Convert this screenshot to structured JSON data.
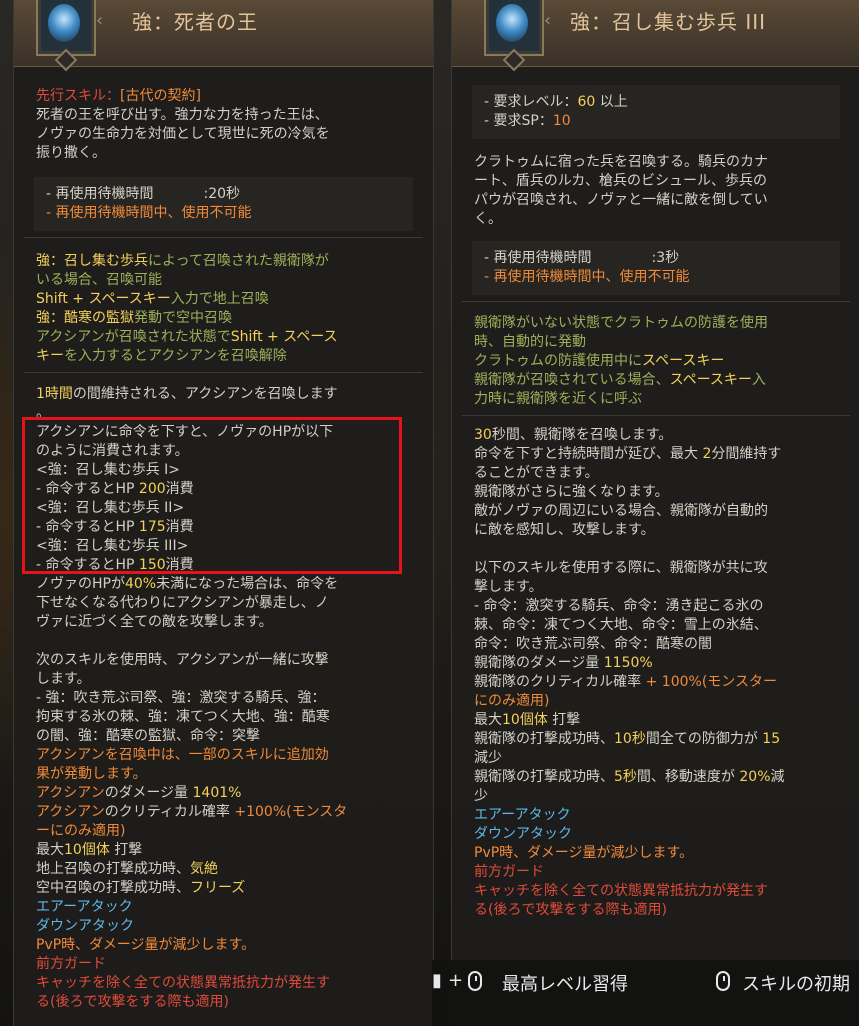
{
  "left": {
    "title": "強：死者の王",
    "prereq_label": "先行スキル：",
    "prereq_value": "[古代の契約]",
    "desc": [
      "死者の王を呼び出す。強力な力を持った王は、",
      "ノヴァの生命力を対価として現世に死の冷気を",
      "振り撒く。"
    ],
    "cooldown_label": "- 再使用待機時間",
    "cooldown_value": ":20秒",
    "cooldown_warning": "- 再使用待機時間中、使用不可能",
    "cond": {
      "l1a": "強：召し集む歩兵",
      "l1b": "によって召喚された親衛隊が",
      "l2": "いる場合、召喚可能",
      "l3a": "Shift + スペースキー",
      "l3b": "入力で地上召喚",
      "l4a": "強：酷寒の監獄",
      "l4b": "発動で空中召喚",
      "l5a": "アクシアンが召喚された状態で",
      "l5b": "Shift + スペース",
      "l6a": "キー",
      "l6b": "を入力するとアクシアンを召喚解除"
    },
    "main": {
      "l1a": "1時間",
      "l1b": "の間維持される、アクシアンを召喚します",
      "l2": "。",
      "l3": "アクシアンに命令を下すと、ノヴァのHPが以下",
      "l4": "のように消費されます。",
      "l5": "<強：召し集む歩兵 I>",
      "l6a": " - 命令するとHP ",
      "l6b": "200",
      "l6c": "消費",
      "l7": " <強：召し集む歩兵 II>",
      "l8a": "  - 命令するとHP ",
      "l8b": "175",
      "l8c": "消費",
      "l9": " <強：召し集む歩兵 III>",
      "l10a": "  - 命令するとHP ",
      "l10b": "150",
      "l10c": "消費",
      "l11a": "ノヴァのHPが",
      "l11b": "40%",
      "l11c": "未満になった場合は、命令を",
      "l12": "下せなくなる代わりにアクシアンが暴走し、ノ",
      "l13": "ヴァに近づく全ての敵を攻撃します。",
      "l14": "次のスキルを使用時、アクシアンが一緒に攻撃",
      "l15": "します。",
      "l16": " - 強：吹き荒ぶ司祭、強：激突する騎兵、強：",
      "l17": "拘束する氷の棘、強：凍てつく大地、強：酷寒",
      "l18": "の闇、強：酷寒の監獄、命令：突撃",
      "l19": "アクシアンを召喚中は、一部のスキルに追加効",
      "l20": "果が発動します。",
      "l21a": "アクシアン",
      "l21b": "のダメージ量 ",
      "l21c": "1401%",
      "l22a": "アクシアン",
      "l22b": "のクリティカル確率 ",
      "l22c": "+100%(モンスタ",
      "l23": "ーにのみ適用)",
      "l24a": "最大",
      "l24b": "10個体",
      "l24c": " 打撃",
      "l25a": "地上召喚の打撃成功時、",
      "l25b": "気絶",
      "l26a": "空中召喚の打撃成功時、",
      "l26b": "フリーズ",
      "l27": "エアーアタック",
      "l28": "ダウンアタック",
      "l29": "PvP時、ダメージ量が減少します。",
      "l30": "前方ガード",
      "l31": "キャッチを除く全ての状態異常抵抗力が発生す",
      "l32": "る(後ろで攻撃をする際も適用)"
    }
  },
  "right": {
    "title": "強：召し集む歩兵 III",
    "req_level_label": "- 要求レベル：",
    "req_level_value": "60",
    "req_level_suffix": " 以上",
    "req_sp_label": "- 要求SP：",
    "req_sp_value": "10",
    "desc": [
      "クラトゥムに宿った兵を召喚する。騎兵のカナ",
      "ート、盾兵のルカ、槍兵のビシュール、歩兵の",
      "パウが召喚され、ノヴァと一緒に敵を倒してい",
      "く。"
    ],
    "cooldown_label": "- 再使用待機時間",
    "cooldown_value": ":3秒",
    "cooldown_warning": "- 再使用待機時間中、使用不可能",
    "cond": {
      "l1": "親衛隊がいない状態でクラトゥムの防護を使用",
      "l2": "時、自動的に発動",
      "l3a": "クラトゥムの防護使用中に",
      "l3b": "スペースキー",
      "l4a": "親衛隊が召喚されている場合、",
      "l4b": "スペースキー",
      "l4c": "入",
      "l5": "力時に親衛隊を近くに呼ぶ"
    },
    "main": {
      "l1a": "30",
      "l1b": "秒間、親衛隊を召喚します。",
      "l2a": "命令を下すと持続時間が延び、最大 ",
      "l2b": "2",
      "l2c": "分間維持す",
      "l3": "ることができます。",
      "l4": "親衛隊がさらに強くなります。",
      "l5": "敵がノヴァの周辺にいる場合、親衛隊が自動的",
      "l6": "に敵を感知し、攻撃します。",
      "l7": "以下のスキルを使用する際に、親衛隊が共に攻",
      "l8": "撃します。",
      "l9": " - 命令：激突する騎兵、命令：湧き起こる氷の",
      "l10": "棘、命令：凍てつく大地、命令：雪上の氷結、",
      "l11": "命令：吹き荒ぶ司祭、命令：酷寒の闇",
      "l12a": "親衛隊のダメージ量 ",
      "l12b": "1150%",
      "l13a": "親衛隊のクリティカル確率 ",
      "l13b": "+ 100%(モンスター",
      "l14": "にのみ適用)",
      "l15a": "最大",
      "l15b": "10個体",
      "l15c": " 打撃",
      "l16a": "親衛隊の打撃成功時、",
      "l16b": "10秒",
      "l16c": "間全ての防御力が ",
      "l16d": "15",
      "l17": "減少",
      "l18a": "親衛隊の打撃成功時、",
      "l18b": "5秒",
      "l18c": "間、移動速度が ",
      "l18d": "20%",
      "l18e": "減",
      "l19": "少",
      "l20": "エアーアタック",
      "l21": "ダウンアタック",
      "l22": "PvP時、ダメージ量が減少します。",
      "l23": "前方ガード",
      "l24": "キャッチを除く全ての状態異常抵抗力が発生す",
      "l25": "る(後ろで攻撃をする際も適用)"
    }
  },
  "bottom": {
    "plus": "+",
    "learn_max": "最高レベル習得",
    "reset": "スキルの初期"
  }
}
